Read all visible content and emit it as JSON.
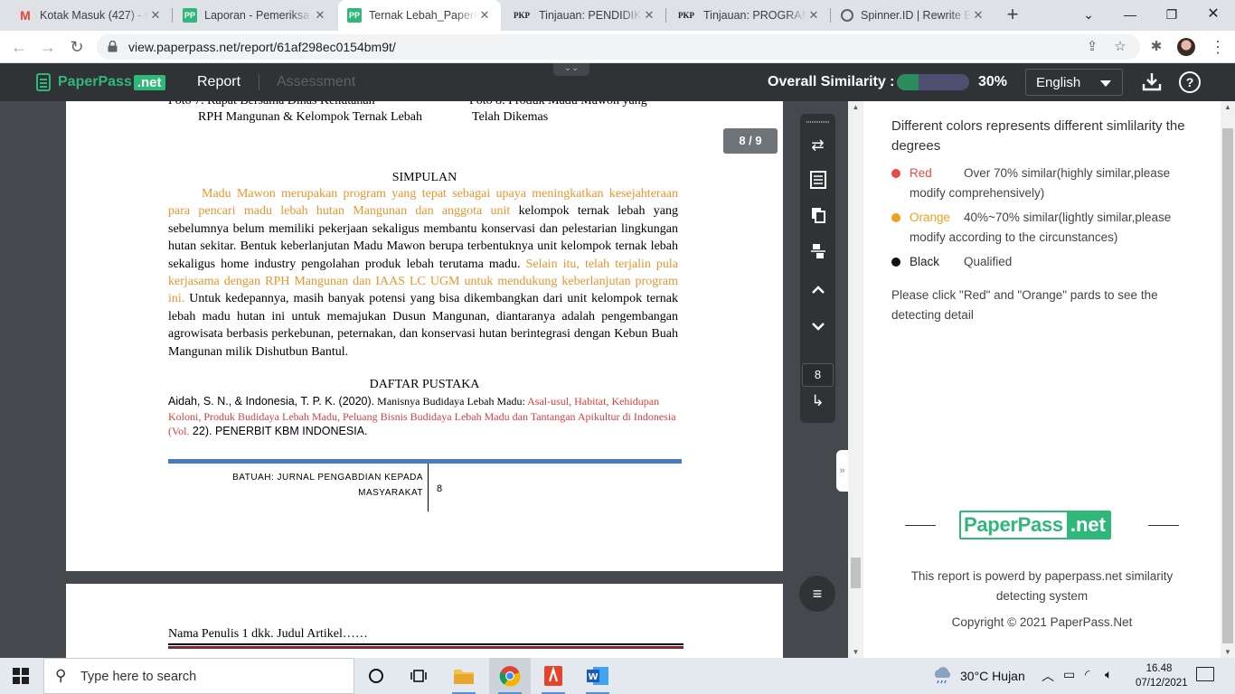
{
  "browser": {
    "tabs": [
      {
        "favicon": "gmail-icon",
        "title": "Kotak Masuk (427) - m",
        "active": false
      },
      {
        "favicon": "pp-icon",
        "title": "Laporan - Pemeriksa P",
        "active": false
      },
      {
        "favicon": "pp-icon",
        "title": "Ternak Lebah_PaperPa",
        "active": true
      },
      {
        "favicon": "pkp-icon",
        "title": "Tinjauan: PENDIDIKAN",
        "active": false
      },
      {
        "favicon": "pkp-icon",
        "title": "Tinjauan: PROGRAM K",
        "active": false
      },
      {
        "favicon": "globe-icon",
        "title": "Spinner.ID | Rewrite Er",
        "active": false
      }
    ],
    "url": "view.paperpass.net/report/61af298ec0154bm9t/"
  },
  "header": {
    "brand": "PaperPass",
    "brand_suffix": ".net",
    "nav_report": "Report",
    "nav_assessment": "Assessment",
    "similarity_label": "Overall Similarity :",
    "similarity_value": "30%",
    "similarity_fraction": 0.3,
    "language": "English"
  },
  "viewer": {
    "page_badge": "8 / 9",
    "current_page": "8",
    "caption_left_1": "Foto 7. Rapat Bersama Dinas Kehutanan",
    "caption_left_2": "RPH Mangunan & Kelompok Ternak Lebah",
    "caption_right_1": "Foto 8. Produk Madu Mawon yang",
    "caption_right_2": "Telah Dikemas",
    "simpulan_heading": "SIMPULAN",
    "simpulan_orange_1": "Madu Mawon merupakan program yang tepat sebagai upaya meningkatkan kesejahteraan para pencari madu lebah hutan Mangunan dan anggota unit",
    "simpulan_black_1": " kelompok ternak lebah yang sebelumnya belum memiliki pekerjaan sekaligus membantu konservasi dan pelestarian lingkungan hutan sekitar. Bentuk keberlanjutan Madu Mawon berupa terbentuknya unit kelompok ternak lebah sekaligus home industry pengolahan produk lebah terutama madu. ",
    "simpulan_orange_2": "Selain itu, telah terjalin pula kerjasama dengan RPH Mangunan dan IAAS LC UGM untuk mendukung keberlanjutan program ini.",
    "simpulan_black_2": " Untuk kedepannya, masih banyak potensi yang bisa dikembangkan dari unit kelompok ternak lebah madu hutan ini untuk memajukan Dusun Mangunan, diantaranya adalah pengembangan agrowisata berbasis perkebunan, peternakan, dan konservasi hutan berintegrasi dengan Kebun Buah Mangunan milik Dishutbun Bantul.",
    "dapus_heading": "DAFTAR PUSTAKA",
    "ref_black_1": "Aidah, S. N., & Indonesia, T. P. K. (2020).",
    "ref_black_2": " Manisnya Budidaya Lebah Madu: ",
    "ref_red": "Asal-usul, Habitat, Kehidupan Koloni, Produk Budidaya Lebah Madu, Peluang Bisnis Budidaya Lebah Madu dan Tantangan Apikultur di Indonesia (Vol.",
    "ref_black_3": " 22). ",
    "ref_black_4": "PENERBIT KBM INDONESIA.",
    "footer_journal_1": "BATUAH: JURNAL PENGABDIAN KEPADA",
    "footer_journal_2": "MASYARAKAT",
    "footer_page": "8",
    "page2_title": "Nama Penulis 1 dkk. Judul Artikel……"
  },
  "panel": {
    "title": "Different colors represents different simlilarity the degrees",
    "legend": [
      {
        "name": "Red",
        "color": "#e54b4b",
        "desc": "Over 70% similar(highly similar,please",
        "desc2": "modify comprehensively)"
      },
      {
        "name": "Orange",
        "color": "#f0a020",
        "desc": "40%~70% similar(lightly similar,please",
        "desc2": "modify according to the circunstances)"
      },
      {
        "name": "Black",
        "color": "#111111",
        "desc": "Qualified",
        "desc2": ""
      }
    ],
    "note": "Please click \"Red\" and \"Orange\" pards to see the detecting detail",
    "logo_a": "PaperPass",
    "logo_b": ".net",
    "powered": "This report is powerd by paperpass.net similarity detecting system",
    "copyright": "Copyright © 2021 PaperPass.Net"
  },
  "taskbar": {
    "search_placeholder": "Type here to search",
    "weather": "30°C  Hujan",
    "time": "16.48",
    "date": "07/12/2021"
  }
}
